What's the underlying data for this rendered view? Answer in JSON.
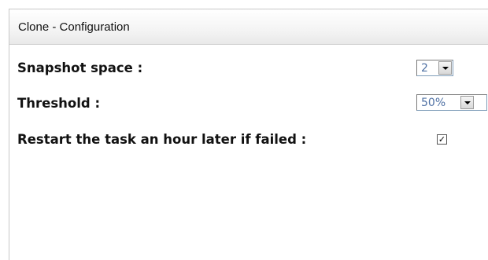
{
  "panel": {
    "title": "Clone - Configuration"
  },
  "snapshot_space": {
    "label": "Snapshot space :",
    "selected_value": "2"
  },
  "threshold": {
    "label": "Threshold :",
    "selected_value": "50%"
  },
  "restart_task": {
    "label": "Restart the task an hour later if failed :",
    "checked": true,
    "check_glyph": "✓"
  },
  "colors": {
    "select_value_text": "#4d6fa3",
    "header_gradient_end": "#e9e9e9"
  }
}
